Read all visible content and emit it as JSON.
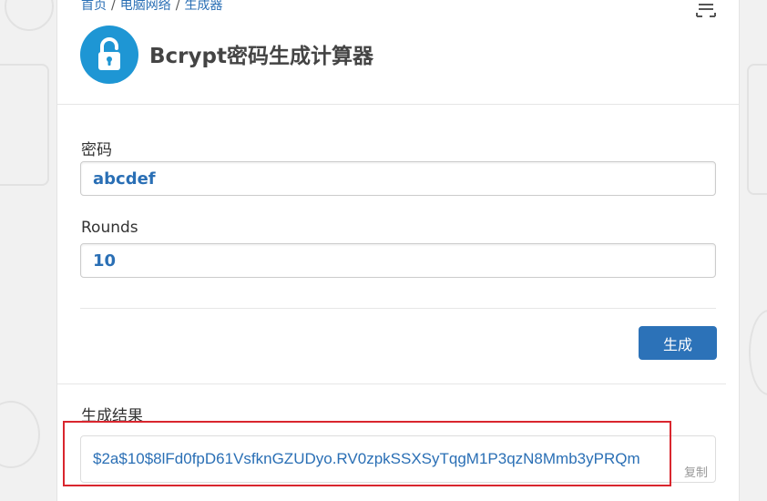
{
  "breadcrumb": {
    "home": "首页",
    "category": "电脑网络",
    "section": "生成器",
    "separator": "/"
  },
  "header": {
    "title": "Bcrypt密码生成计算器",
    "icon": "lock-icon",
    "icon_bg": "#1e96d4",
    "menu_icon": "list-menu-icon"
  },
  "form": {
    "password_label": "密码",
    "password_value": "abcdef",
    "rounds_label": "Rounds",
    "rounds_value": "10",
    "generate_label": "生成"
  },
  "result": {
    "label": "生成结果",
    "value": "$2a$10$8lFd0fpD61VsfknGZUDyo.RV0zpkSSXSyTqgM1P3qzN8Mmb3yPRQm",
    "copy_label": "复制"
  },
  "colors": {
    "accent": "#2c72b8",
    "link": "#2a6fb5",
    "highlight": "#d9262e"
  }
}
